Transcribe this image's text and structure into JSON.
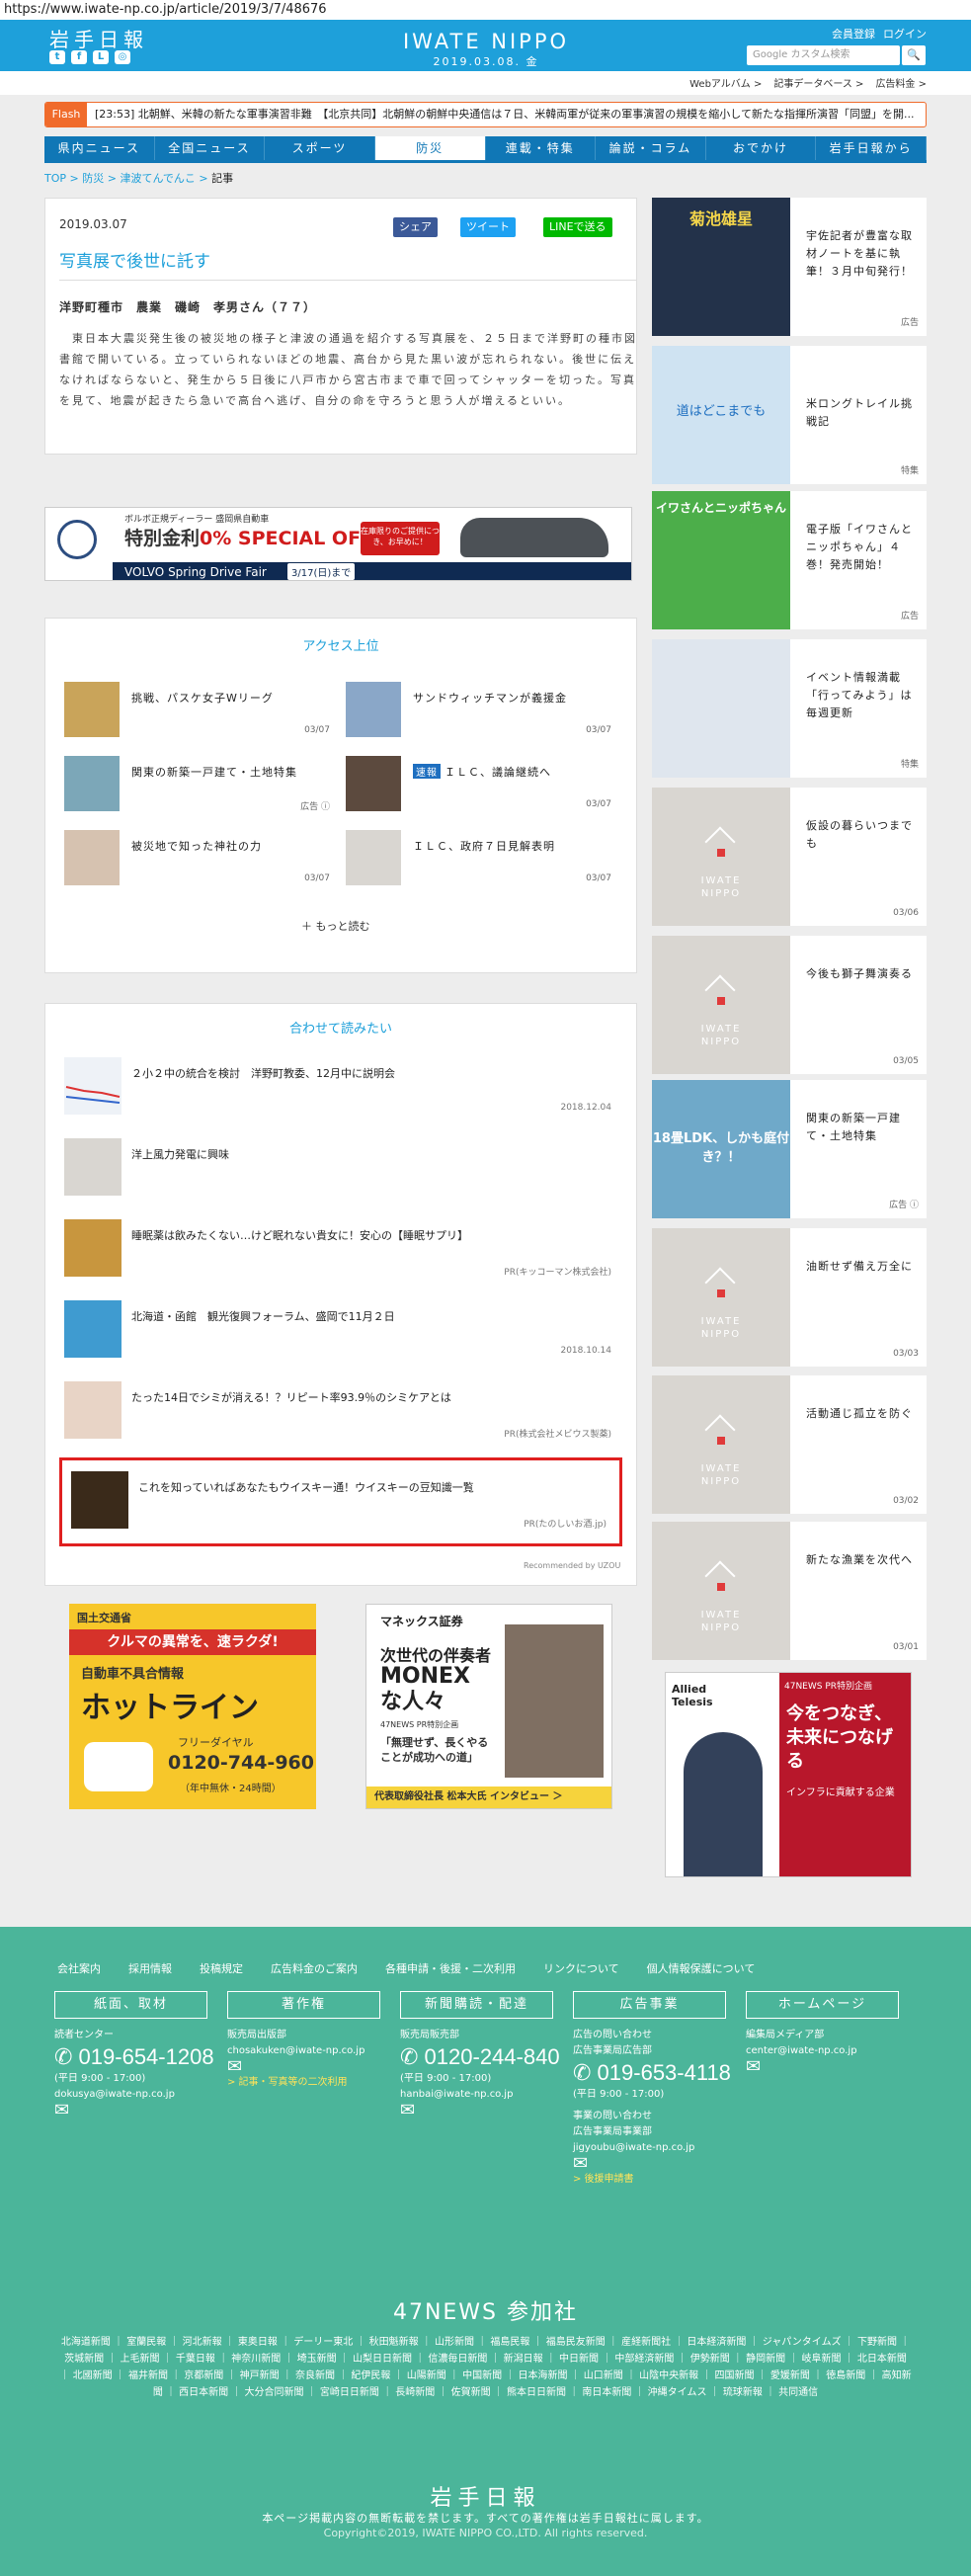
{
  "url": "https://www.iwate-np.co.jp/article/2019/3/7/48676",
  "header": {
    "logo_jp": "岩手日報",
    "brand": "IWATE NIPPO",
    "date": "2019.03.08. 金",
    "member_register": "会員登録",
    "login": "ログイン",
    "search_placeholder": "Google カスタム検索"
  },
  "subbar": {
    "links": [
      "Webアルバム >",
      "記事データベース >",
      "広告料金 >"
    ]
  },
  "flash": {
    "badge": "Flash",
    "text": "[23:53] 北朝鮮、米韓の新たな軍事演習非難　【北京共同】北朝鮮の朝鮮中央通信は７日、米韓両軍が従来の軍事演習の規模を縮小して新たな指揮所演習「同盟」を開..."
  },
  "nav": [
    "県内ニュース",
    "全国ニュース",
    "スポーツ",
    "防災",
    "連載・特集",
    "論説・コラム",
    "おでかけ",
    "岩手日報から"
  ],
  "breadcrumb": {
    "top": "TOP",
    "l1": "防災",
    "l2": "津波てんでんこ",
    "current": "記事"
  },
  "article": {
    "date": "2019.03.07",
    "share": "シェア",
    "tweet": "ツイート",
    "line": "LINEで送る",
    "title": "写真展で後世に託す",
    "photo_caption": "洋野町種市　農業　磯崎　孝男さん（７７）",
    "body": "　東日本大震災発生後の被災地の様子と津波の通過を紹介する写真展を、２５日まで洋野町の種市図書館で開いている。立っていられないほどの地震、高台から見た黒い波が忘れられない。後世に伝えなければならないと、発生から５日後に八戸市から宮古市まで車で回ってシャッターを切った。写真を見て、地震が起きたら急いで高台へ逃げ、自分の命を守ろうと思う人が増えるといい。"
  },
  "ad_volvo": {
    "t1": "ボルボ正規ディーラー 盛岡県自動車",
    "t2a": "特別金利",
    "t2b": "0%",
    "t2c": "SPECIAL OFFER",
    "badge": "在庫限りのご提供につき、お早めに！",
    "bar": "VOLVO Spring Drive Fair",
    "date": "3/17(日)まで"
  },
  "ranking": {
    "title": "アクセス上位",
    "items": [
      {
        "title": "挑戦、パスケ女子Wリーグ",
        "date": "03/07",
        "tag": ""
      },
      {
        "title": "サンドウィッチマンが義援金",
        "date": "03/07",
        "tag": ""
      },
      {
        "title": "関東の新築一戸建て・土地特集",
        "date": "広告 ⓘ",
        "tag": ""
      },
      {
        "title": "ＩＬＣ、議論継続へ",
        "date": "03/07",
        "tag": "速報"
      },
      {
        "title": "被災地で知った神社の力",
        "date": "03/07",
        "tag": ""
      },
      {
        "title": "ＩＬＣ、政府７日見解表明",
        "date": "03/07",
        "tag": ""
      }
    ],
    "more": "もっと読む"
  },
  "recommend": {
    "title": "合わせて読みたい",
    "items": [
      {
        "title": "２小２中の統合を検討　洋野町教委、12月中に説明会",
        "date": "2018.12.04"
      },
      {
        "title": "洋上風力発電に興味",
        "date": ""
      },
      {
        "title": "睡眠薬は飲みたくない…けど眠れない貴女に！安心の【睡眠サプリ】",
        "date": "PR(キッコーマン株式会社)"
      },
      {
        "title": "北海道・函館　観光復興フォーラム、盛岡で11月２日",
        "date": "2018.10.14"
      },
      {
        "title": "たった14日でシミが消える！？リピート率93.9％のシミケアとは",
        "date": "PR(株式会社メビウス製薬)"
      },
      {
        "title": "これを知っていればあなたもウイスキー通！ウイスキーの豆知識一覧",
        "date": "PR(たのしいお酒.jp)"
      }
    ],
    "powered": "Recommended by UZOU"
  },
  "sidebar": [
    {
      "title": "宇佐記者が豊富な取材ノートを基に執筆！３月中旬発行！",
      "date": "広告",
      "thumb": "菊池雄星"
    },
    {
      "title": "米ロングトレイル挑戦記",
      "date": "特集",
      "thumb": "道はどこまでも"
    },
    {
      "title": "電子版「イワさんとニッポちゃん」４巻！発売開始！",
      "date": "広告",
      "thumb": "イワさんとニッポちゃん"
    },
    {
      "title": "イベント情報満載「行ってみよう」は毎週更新",
      "date": "特集",
      "thumb": ""
    },
    {
      "title": "仮設の暮らいつまでも",
      "date": "03/06",
      "thumb": ""
    },
    {
      "title": "今後も獅子舞演奏る",
      "date": "03/05",
      "thumb": ""
    },
    {
      "title": "関東の新築一戸建て・土地特集",
      "date": "広告 ⓘ",
      "thumb": "18畳LDK、しかも庭付き？！"
    },
    {
      "title": "油断せず備え万全に",
      "date": "03/03",
      "thumb": ""
    },
    {
      "title": "活動通じ孤立を防ぐ",
      "date": "03/02",
      "thumb": ""
    },
    {
      "title": "新たな漁業を次代へ",
      "date": "03/01",
      "thumb": ""
    }
  ],
  "ad_bottom": {
    "kokudo": {
      "org": "国土交通省",
      "l1": "クルマの異常を、速ラクダ!",
      "l2": "自動車不具合情報",
      "l3": "ホットライン",
      "l4": "フリーダイヤル",
      "phone": "0120-744-960",
      "hours": "（年中無休・24時間）"
    },
    "monex": {
      "org": "マネックス証券",
      "l1": "次世代の伴奏者",
      "l2": "MONEXな人々",
      "l3": "47NEWS PR特別企画",
      "quote": "「無理せず、長くやることが成功への道」",
      "foot": "代表取締役社長 松本大氏 インタビュー ＞"
    },
    "allied": {
      "org": "Allied Telesis",
      "label": "47NEWS PR特別企画",
      "l1": "今をつなぎ、未来につなげる",
      "l2": "インフラに貢献する企業"
    }
  },
  "footer": {
    "links": [
      "会社案内",
      "採用情報",
      "投稿規定",
      "広告料金のご案内",
      "各種申請・後援・二次利用",
      "リンクについて",
      "個人情報保護について"
    ],
    "buttons": [
      "紙面、取材",
      "著作権",
      "新聞購読・配達",
      "広告事業",
      "ホームページ"
    ],
    "col1": {
      "label": "読者センター",
      "phone": "019-654-1208",
      "hours": "(平日 9:00 - 17:00)",
      "email": "dokusya@iwate-np.co.jp"
    },
    "col2": {
      "label": "販売局出版部",
      "email": "chosakuken@iwate-np.co.jp",
      "link": "> 記事・写真等の二次利用"
    },
    "col3": {
      "label": "販売局販売部",
      "phone": "0120-244-840",
      "hours": "(平日 9:00 - 17:00)",
      "email": "hanbai@iwate-np.co.jp"
    },
    "col4": {
      "label1": "広告の問い合わせ",
      "label2": "広告事業局広告部",
      "phone": "019-653-4118",
      "hours": "(平日 9:00 - 17:00)",
      "label3": "事業の問い合わせ",
      "label4": "広告事業局事業部",
      "email": "jigyoubu@iwate-np.co.jp",
      "link": "> 後援申請書"
    },
    "col5": {
      "label": "編集局メディア部",
      "email": "center@iwate-np.co.jp"
    },
    "n47": "47NEWS 参加社",
    "papers": "北海道新聞 ｜ 室蘭民報 ｜ 河北新報 ｜ 東奥日報 ｜ デーリー東北 ｜ 秋田魁新報 ｜ 山形新聞 ｜ 福島民報 ｜ 福島民友新聞 ｜ 産経新聞社 ｜ 日本経済新聞 ｜ ジャパンタイムズ ｜ 下野新聞 ｜ 茨城新聞 ｜ 上毛新聞 ｜ 千葉日報 ｜ 神奈川新聞 ｜ 埼玉新聞 ｜ 山梨日日新聞 ｜ 信濃毎日新聞 ｜ 新潟日報 ｜ 中日新聞 ｜ 中部経済新聞 ｜ 伊勢新聞 ｜ 静岡新聞 ｜ 岐阜新聞 ｜ 北日本新聞 ｜ 北國新聞 ｜ 福井新聞 ｜ 京都新聞 ｜ 神戸新聞 ｜ 奈良新聞 ｜ 紀伊民報 ｜ 山陽新聞 ｜ 中国新聞 ｜ 日本海新聞 ｜ 山口新聞 ｜ 山陰中央新報 ｜ 四国新聞 ｜ 愛媛新聞 ｜ 徳島新聞 ｜ 高知新聞 ｜ 西日本新聞 ｜ 大分合同新聞 ｜ 宮崎日日新聞 ｜ 長崎新聞 ｜ 佐賀新聞 ｜ 熊本日日新聞 ｜ 南日本新聞 ｜ 沖縄タイムス ｜ 琉球新報 ｜ 共同通信",
    "logo": "岩手日報",
    "copy1": "本ページ掲載内容の無断転載を禁じます。すべての著作権は岩手日報社に属します。",
    "copy2": "Copyright©2019, IWATE NIPPO CO.,LTD. All rights reserved."
  },
  "colors": {
    "brand_blue": "#1ea0da",
    "nav_blue": "#1077b6",
    "flash_orange": "#f06b2b",
    "footer_green": "#4bb59a",
    "highlight_red": "#e02020"
  }
}
